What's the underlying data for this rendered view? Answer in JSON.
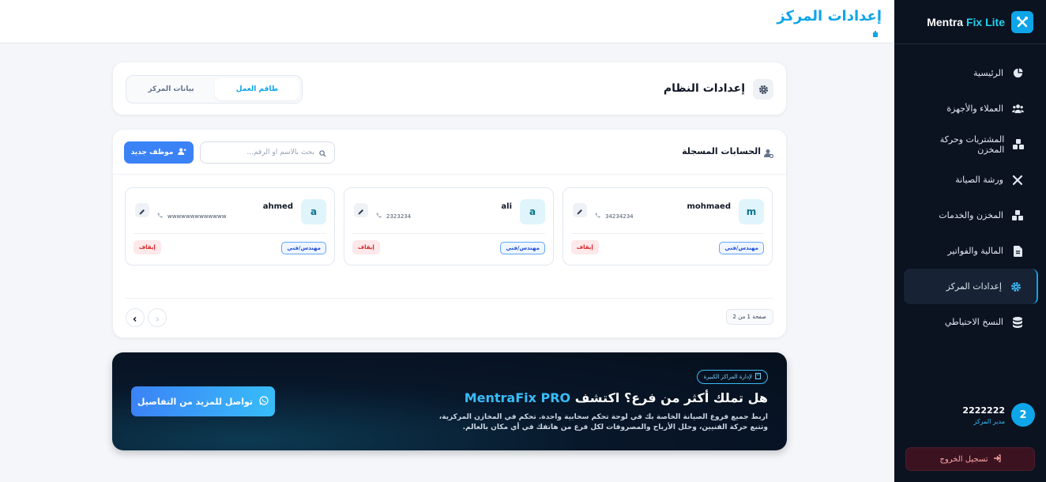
{
  "sidebar": {
    "brand_main": "Mentra",
    "brand_accent": "Fix Lite",
    "items": [
      {
        "label": "الرئيسية",
        "icon": "pie-chart-icon"
      },
      {
        "label": "العملاء والأجهزة",
        "icon": "users-icon"
      },
      {
        "label": "المشتريات وحركة المخزن",
        "icon": "boxes-icon"
      },
      {
        "label": "ورشة الصيانة",
        "icon": "tools-icon"
      },
      {
        "label": "المخزن والخدمات",
        "icon": "boxes-icon"
      },
      {
        "label": "المالية والفواتير",
        "icon": "invoice-icon"
      },
      {
        "label": "إعدادات المركز",
        "icon": "gear-icon",
        "active": true
      },
      {
        "label": "النسخ الاحتياطي",
        "icon": "database-icon"
      }
    ],
    "user": {
      "avatar": "2",
      "name": "2222222",
      "role": "مدير المركز"
    },
    "logout_label": "تسجيل الخروج"
  },
  "header": {
    "title": "إعدادات المركز"
  },
  "system": {
    "title": "إعدادات النظام",
    "tabs": [
      {
        "label": "طاقم العمل",
        "active": true
      },
      {
        "label": "بيانات المركز",
        "active": false
      }
    ]
  },
  "accounts": {
    "title": "الحسابات المسجلة",
    "search_placeholder": "بحث بالاسم أو الرقم...",
    "add_label": "موظف جديد",
    "employees": [
      {
        "avatar": "m",
        "name": "mohmaed",
        "phone": "34234234",
        "role": "مهندس/فني",
        "action": "إيقاف"
      },
      {
        "avatar": "a",
        "name": "ali",
        "phone": "2323234",
        "role": "مهندس/فني",
        "action": "إيقاف"
      },
      {
        "avatar": "a",
        "name": "ahmed",
        "phone": "wwwwwwwwwwwww",
        "role": "مهندس/فني",
        "action": "إيقاف"
      }
    ],
    "page_info": "صفحة 1 من 2"
  },
  "promo": {
    "badge": "لإدارة المراكز الكبيرة",
    "title_pre": "هل تملك أكثر من فرع؟ اكتشف ",
    "title_brand": "MentraFix PRO",
    "desc": "اربط جميع فروع الصيانة الخاصة بك في لوحة تحكم سحابية واحدة. تحكم في المخازن المركزية، وتتبع حركة الفنيين، وحلل الأرباح والمصروفات لكل فرع من هاتفك في أي مكان بالعالم.",
    "button": "تواصل للمزيد من التفاصيل"
  },
  "colors": {
    "accent": "#0ea5e9",
    "sidebar_bg": "#0b1220",
    "primary_button": "#3b82f6",
    "danger": "#dc2626"
  }
}
